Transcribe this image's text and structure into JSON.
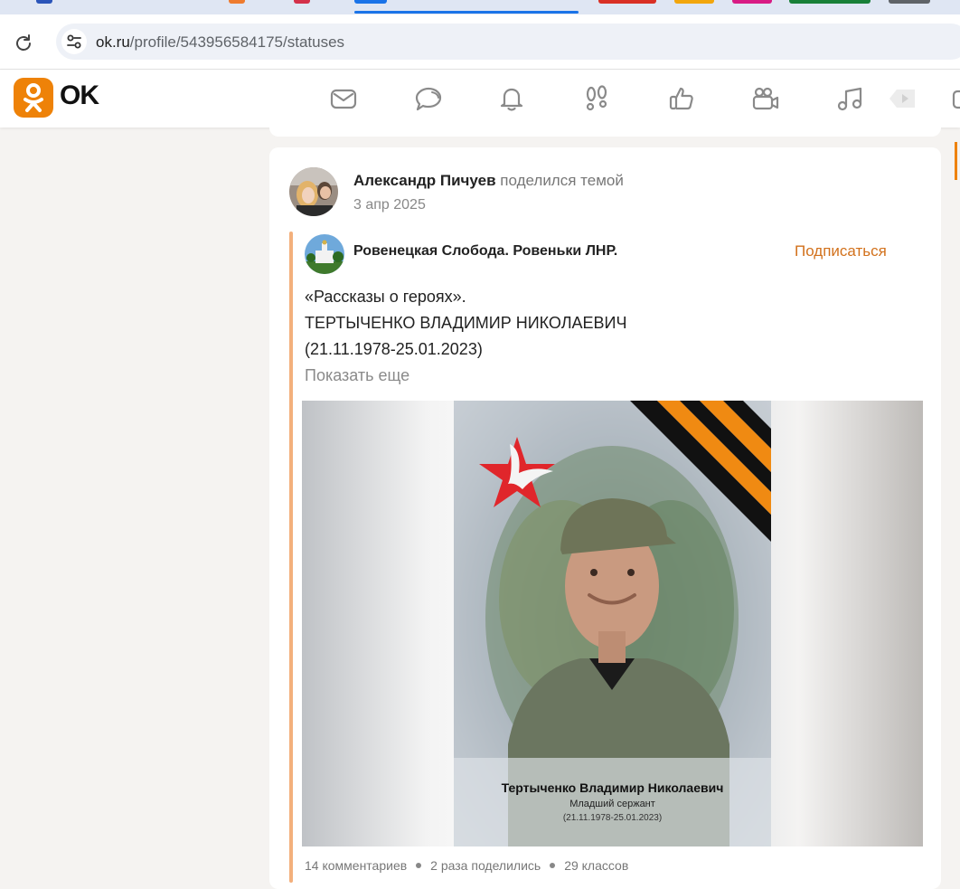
{
  "browser": {
    "url_host": "ok.ru",
    "url_path": "/profile/543956584175/statuses",
    "tab_colors": [
      "#2b55b9",
      "#ee7b2e",
      "#d4314a",
      "#1a73e8",
      "#d93025",
      "#f2a60c",
      "#d81b84",
      "#188038",
      "#5f6368"
    ]
  },
  "site": {
    "logo_text": "OK",
    "brand_color": "#ee8208",
    "nav_icons": [
      "mail-icon",
      "chat-icon",
      "bell-icon",
      "footprints-icon",
      "thumbs-up-icon",
      "video-camera-icon",
      "music-icon",
      "video-play-icon"
    ]
  },
  "post": {
    "author": "Александр Пичуев",
    "action": "поделился темой",
    "date": "3 апр 2025",
    "group": {
      "name": "Ровенецкая Слобода. Ровеньки ЛНР.",
      "subscribe_label": "Подписаться"
    },
    "text_lines": [
      "«Рассказы о героях».",
      "ТЕРТЫЧЕНКО ВЛАДИМИР НИКОЛАЕВИЧ",
      "(21.11.1978-25.01.2023)"
    ],
    "show_more": "Показать еще",
    "photo": {
      "name": "Тертыченко Владимир Николаевич",
      "rank": "Младший сержант",
      "dates": "(21.11.1978-25.01.2023)"
    },
    "stats": {
      "comments": "14 комментариев",
      "shares": "2 раза поделились",
      "likes": "29 классов"
    }
  }
}
